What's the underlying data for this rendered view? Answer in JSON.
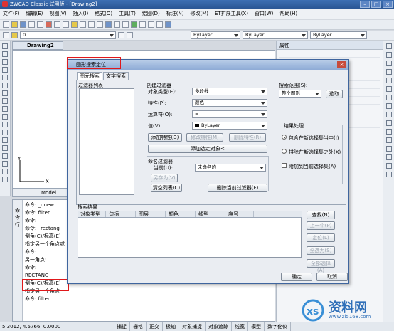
{
  "app": {
    "title": "ZWCAD Classic 试用版 - [Drawing2]"
  },
  "menu": [
    "文件(F)",
    "编辑(E)",
    "视图(V)",
    "插入(I)",
    "格式(O)",
    "工具(T)",
    "绘图(D)",
    "标注(N)",
    "修改(M)",
    "ET扩展工具(X)",
    "窗口(W)",
    "帮助(H)"
  ],
  "toolbar": {
    "layer_value": "0",
    "color_value": "ByLayer",
    "linetype_value": "ByLayer",
    "lineweight_value": "ByLayer"
  },
  "drawing_tab": "Drawing2",
  "properties_title": "属性",
  "layout_tab": "Model",
  "command_history": [
    "命令: _qnew",
    "命令: filter",
    "命令:",
    "命令: _rectang",
    "倒角(C)/标高(E)",
    "指定另一个角点或",
    "命令:",
    "另一角点:",
    "命令:",
    "RECTANG",
    "倒角(C)/标高(E)",
    "指定另一个角点",
    "命令: filter"
  ],
  "dialog": {
    "title": "图形搜索定位",
    "tabs": [
      "图元搜索",
      "文字搜索"
    ],
    "filter_list_label": "过滤器列表",
    "create_filter_label": "创建过滤器",
    "object_type_label": "对象类型(E):",
    "object_type_value": "多段线",
    "property_label": "特性(P):",
    "property_value": "颜色",
    "operator_label": "运算符(O):",
    "operator_value": "=",
    "value_label": "值(V):",
    "value_value": "ByLayer",
    "add_property_btn": "添加特性(D)",
    "modify_property_btn": "修改特性(M)",
    "delete_property_btn": "删除特性(R)",
    "add_selected_btn": "添加选定对象<",
    "named_filter_label": "命名过滤器",
    "current_label": "当前(U):",
    "current_value": "未命名的",
    "save_as_btn": "另存为(V)",
    "clear_list_btn": "清空列表(C)",
    "delete_filter_btn": "删除当前过滤器(F)",
    "search_range_label": "搜索范围(S):",
    "search_range_value": "整个图形",
    "select_btn": "选取",
    "result_processing_label": "结果处理",
    "radio1": "包含在新选择集当中(I)",
    "radio2": "排除在新选择集之外(X)",
    "checkbox": "附加到当前选择集(A)",
    "search_results_label": "搜索结果",
    "columns": [
      "对象类型",
      "句柄",
      "图层",
      "颜色",
      "线型",
      "序号"
    ],
    "find_btn": "查找(N)",
    "prev_btn": "上一个(P)",
    "locate_btn": "定位(L)",
    "select_btn2": "全选为(S)",
    "select_all_btn": "全部选择(A)",
    "ok_btn": "确定",
    "cancel_btn": "取消"
  },
  "status": {
    "coords": "5.3012,  4.5766,  0.0000",
    "buttons": [
      "捕捉",
      "栅格",
      "正交",
      "极轴",
      "对象捕捉",
      "对象追踪",
      "线宽",
      "模型",
      "数字化仪"
    ]
  },
  "watermark": {
    "text": "资料网",
    "url": "www.zl5168.com"
  }
}
